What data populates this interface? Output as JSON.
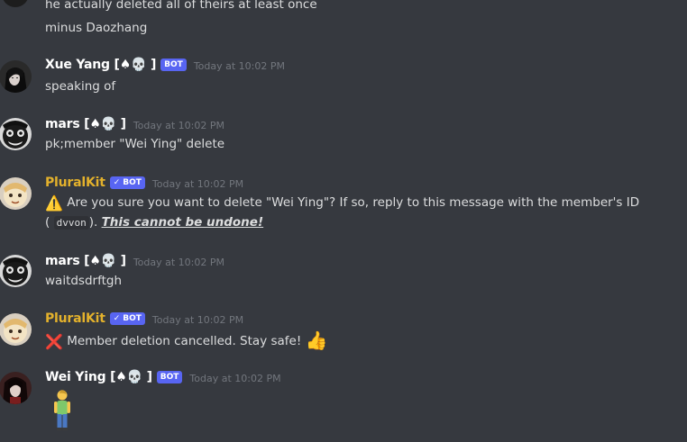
{
  "messages": [
    {
      "id": "m0",
      "lines": [
        "he actually deleted all of theirs at least once",
        "minus Daozhang"
      ]
    },
    {
      "id": "m1",
      "username": "Xue Yang [♠💀 ]",
      "bot": true,
      "bot_label": "BOT",
      "timestamp": "Today at 10:02 PM",
      "text": "speaking of"
    },
    {
      "id": "m2",
      "username": "mars [♠💀 ]",
      "timestamp": "Today at 10:02 PM",
      "text": "pk;member \"Wei Ying\" delete"
    },
    {
      "id": "m3",
      "username": "PluralKit",
      "bot": true,
      "verified": true,
      "bot_label": "BOT",
      "timestamp": "Today at 10:02 PM",
      "line1_emoji": "⚠️",
      "line1": "Are you sure you want to delete \"Wei Ying\"? If so, reply to this message with the member's ID",
      "line2_open": "(",
      "line2_code": "dvvon",
      "line2_close": ").",
      "line2_emph": "This cannot be undone!"
    },
    {
      "id": "m4",
      "username": "mars [♠💀 ]",
      "timestamp": "Today at 10:02 PM",
      "text": "waitdsdrftgh"
    },
    {
      "id": "m5",
      "username": "PluralKit",
      "bot": true,
      "verified": true,
      "bot_label": "BOT",
      "timestamp": "Today at 10:02 PM",
      "emoji_before": "❌",
      "text": "Member deletion cancelled. Stay safe!",
      "emoji_after": "👍"
    },
    {
      "id": "m6",
      "username": "Wei Ying [♠💀 ]",
      "bot": true,
      "bot_label": "BOT",
      "timestamp": "Today at 10:02 PM",
      "emoji_body": "🧍"
    }
  ],
  "colors": {
    "background": "#36393f",
    "text": "#dcddde",
    "username": "#ffffff",
    "pluralkit": "#e3b12c",
    "timestamp": "#72767d",
    "bot_tag": "#5865f2"
  },
  "icons": {
    "avatar_xue_yang": "avatar-icon",
    "avatar_mars": "avatar-icon",
    "avatar_pluralkit": "avatar-icon",
    "avatar_wei_ying": "avatar-icon",
    "verified": "check-icon"
  }
}
